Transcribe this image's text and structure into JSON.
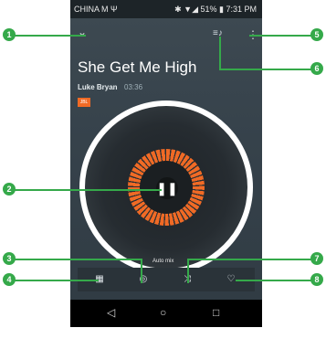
{
  "status_bar": {
    "carrier": "CHINA M",
    "usb": "Ψ",
    "battery_and_time": "✱ ▼◢ 51% ▮ 7:31 PM"
  },
  "header": {
    "collapse_icon": "⌄",
    "queue_icon": "≡♪",
    "more_icon": "⋮"
  },
  "song": {
    "title": "She Get Me High",
    "artist": "Luke Bryan",
    "duration": "03:36",
    "badge": "JBL"
  },
  "player": {
    "pause_symbol": "❚❚",
    "auto_mix_label": "Auto mix"
  },
  "bottom_bar": {
    "btn1": "▦",
    "btn2": "◎",
    "btn3": "⤨",
    "btn4": "♡"
  },
  "nav": {
    "back": "◁",
    "home": "○",
    "recent": "□"
  },
  "callouts": [
    "1",
    "2",
    "3",
    "4",
    "5",
    "6",
    "7",
    "8"
  ]
}
